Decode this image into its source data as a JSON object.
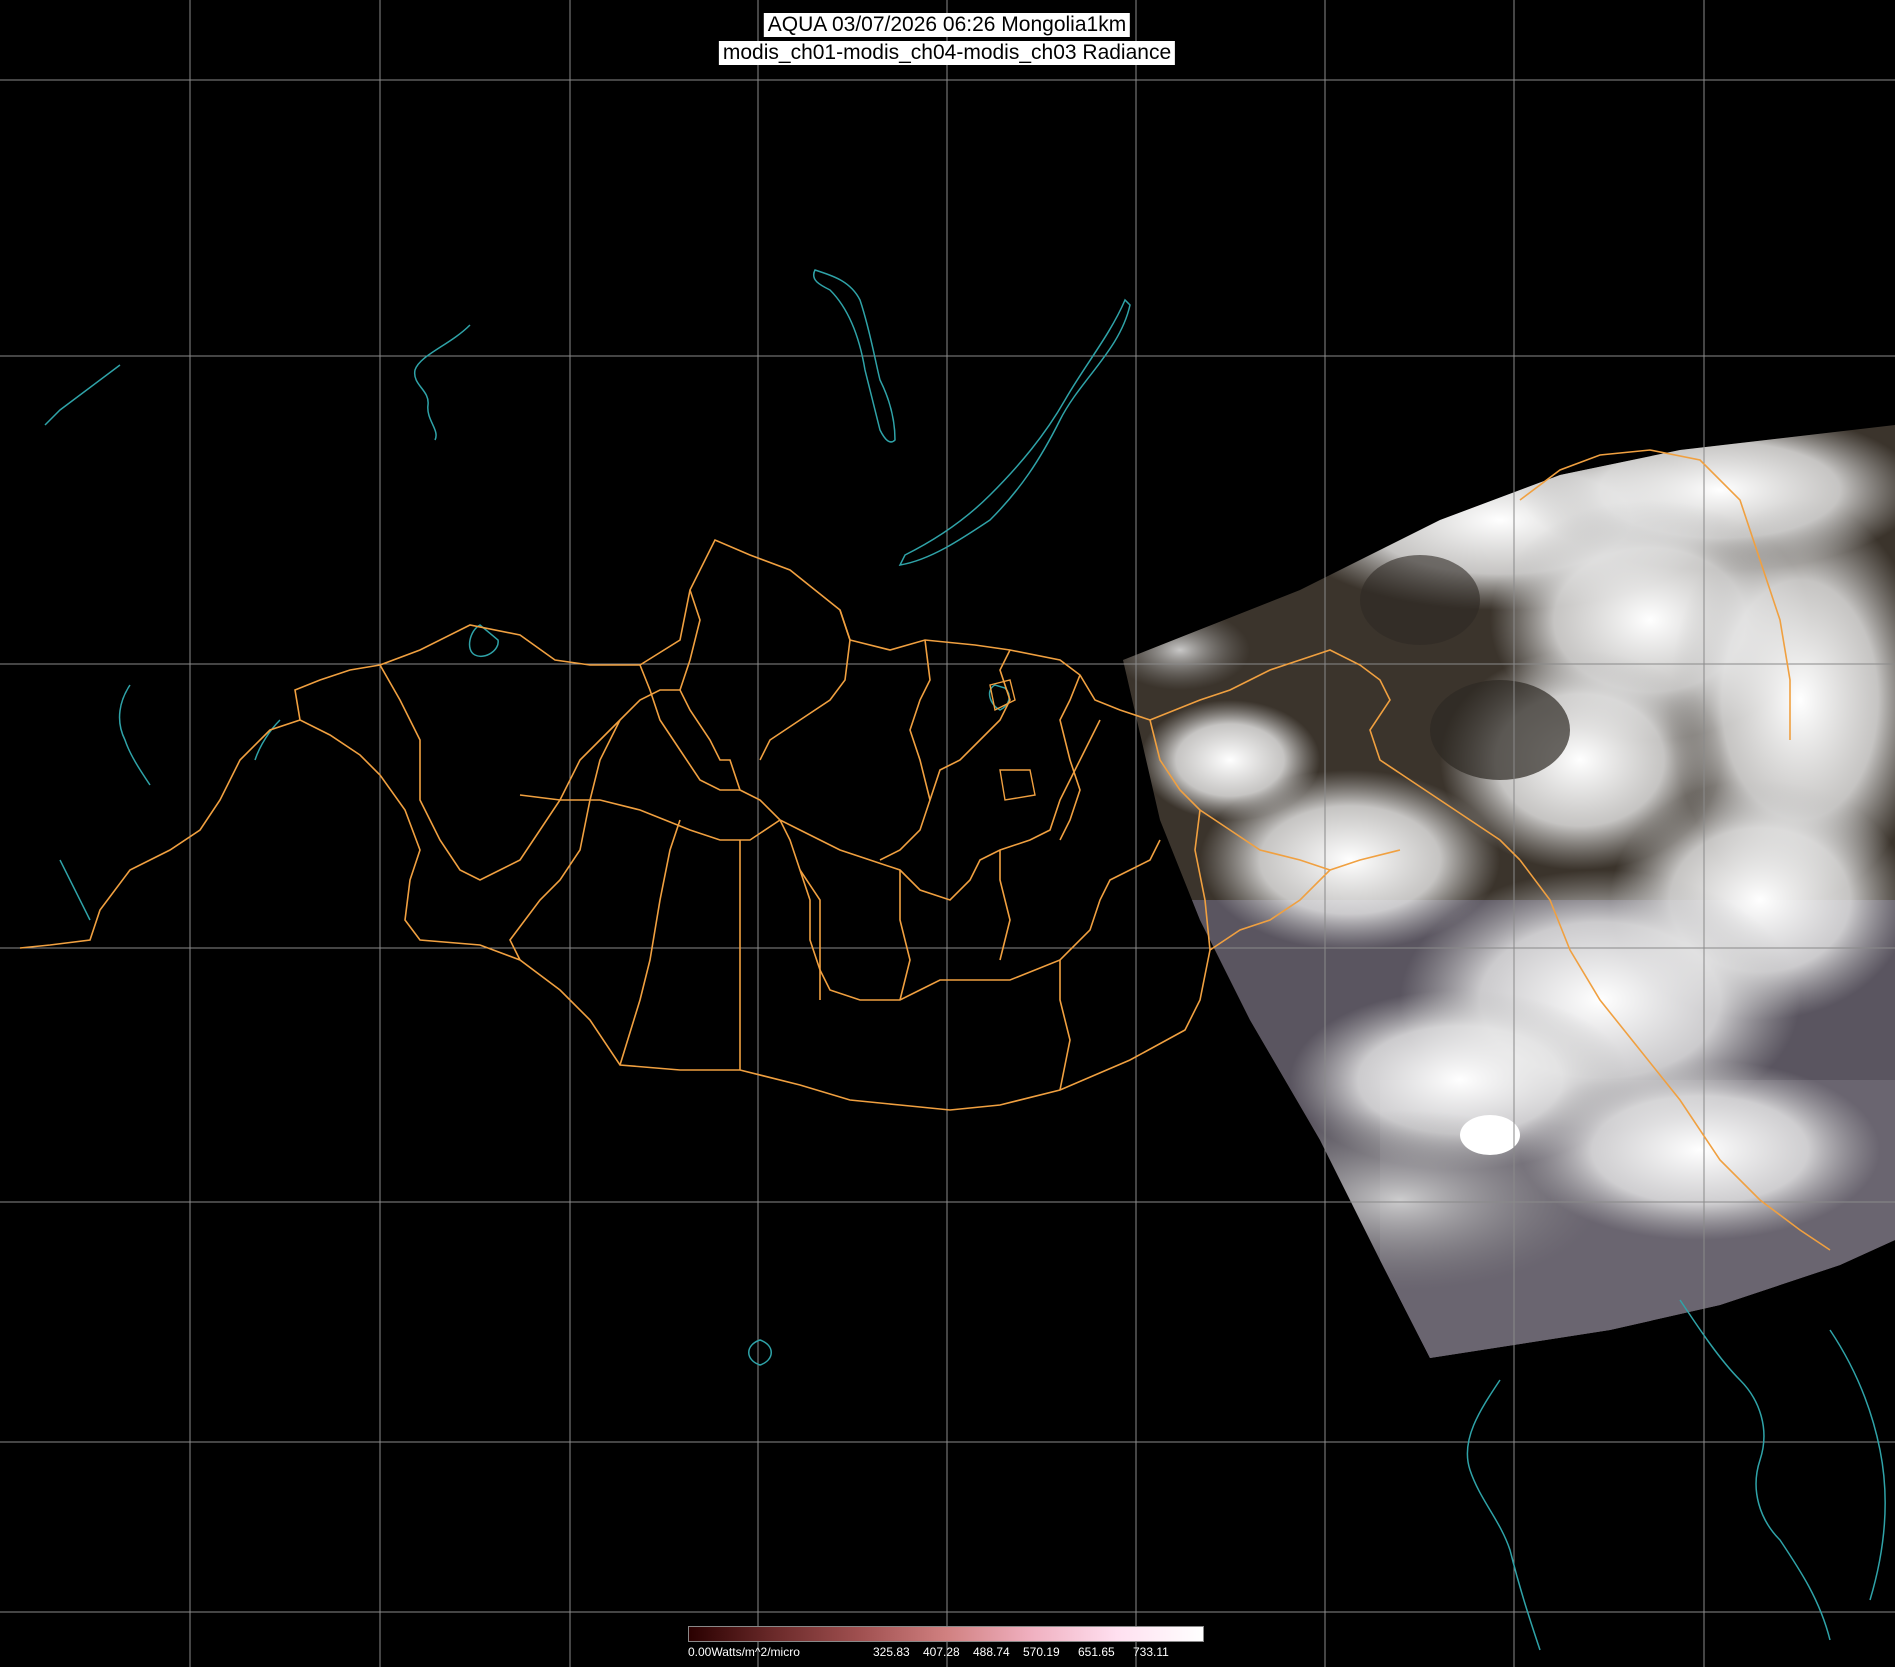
{
  "header": {
    "title_line1": "AQUA 03/07/2026 06:26 Mongolia1km",
    "title_line2": "modis_ch01-modis_ch04-modis_ch03 Radiance"
  },
  "map": {
    "satellite": "AQUA",
    "region": "Mongolia1km",
    "colors": {
      "background": "#000000",
      "graticule": "#8a8a8a",
      "province_borders": "#f0a040",
      "coastlines_lakes": "#2fa3a8",
      "cloud": "#f2f2f2",
      "land": "#3a3026"
    }
  },
  "legend": {
    "unit_label": "0.00Watts/m^2/micro",
    "ticks": [
      "325.83",
      "407.28",
      "488.74",
      "570.19",
      "651.65",
      "733.11"
    ],
    "gradient_colors": [
      "#2a0000",
      "#6b2a2a",
      "#a05050",
      "#d08080",
      "#f0b0c0",
      "#ffe0f0",
      "#ffffff"
    ]
  }
}
